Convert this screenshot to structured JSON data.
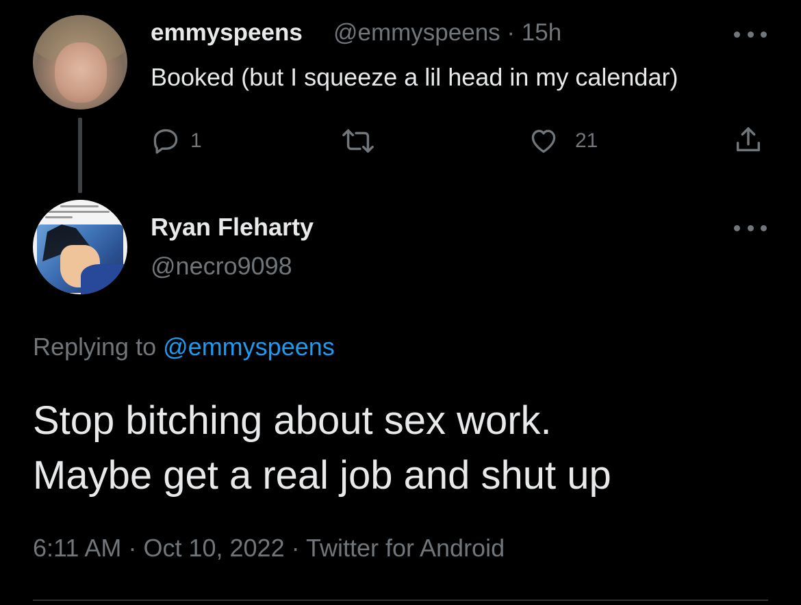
{
  "parent_tweet": {
    "display_name": "emmyspeens",
    "handle": "@emmyspeens",
    "separator": "·",
    "age": "15h",
    "text": "Booked (but I squeeze a lil head in my calendar)",
    "reply_count": "1",
    "retweet_count": "",
    "like_count": "21"
  },
  "main_tweet": {
    "display_name": "Ryan Fleharty",
    "handle": "@necro9098",
    "replying_prefix": "Replying to",
    "replying_to": "@emmyspeens",
    "text_lines": [
      "Stop bitching about sex work.",
      "Maybe get a real job and shut up"
    ],
    "time": "6:11 AM",
    "date": "Oct 10, 2022",
    "source": "Twitter for Android",
    "separator": "·"
  },
  "icons": {
    "more": "more-horizontal-icon",
    "reply": "reply-bubble-icon",
    "retweet": "retweet-icon",
    "like": "heart-icon",
    "share": "share-icon"
  },
  "colors": {
    "background": "#000000",
    "primary_text": "#e7e9ea",
    "secondary_text": "#71767b",
    "link": "#1d9bf0",
    "thread_line": "#3e4144"
  }
}
